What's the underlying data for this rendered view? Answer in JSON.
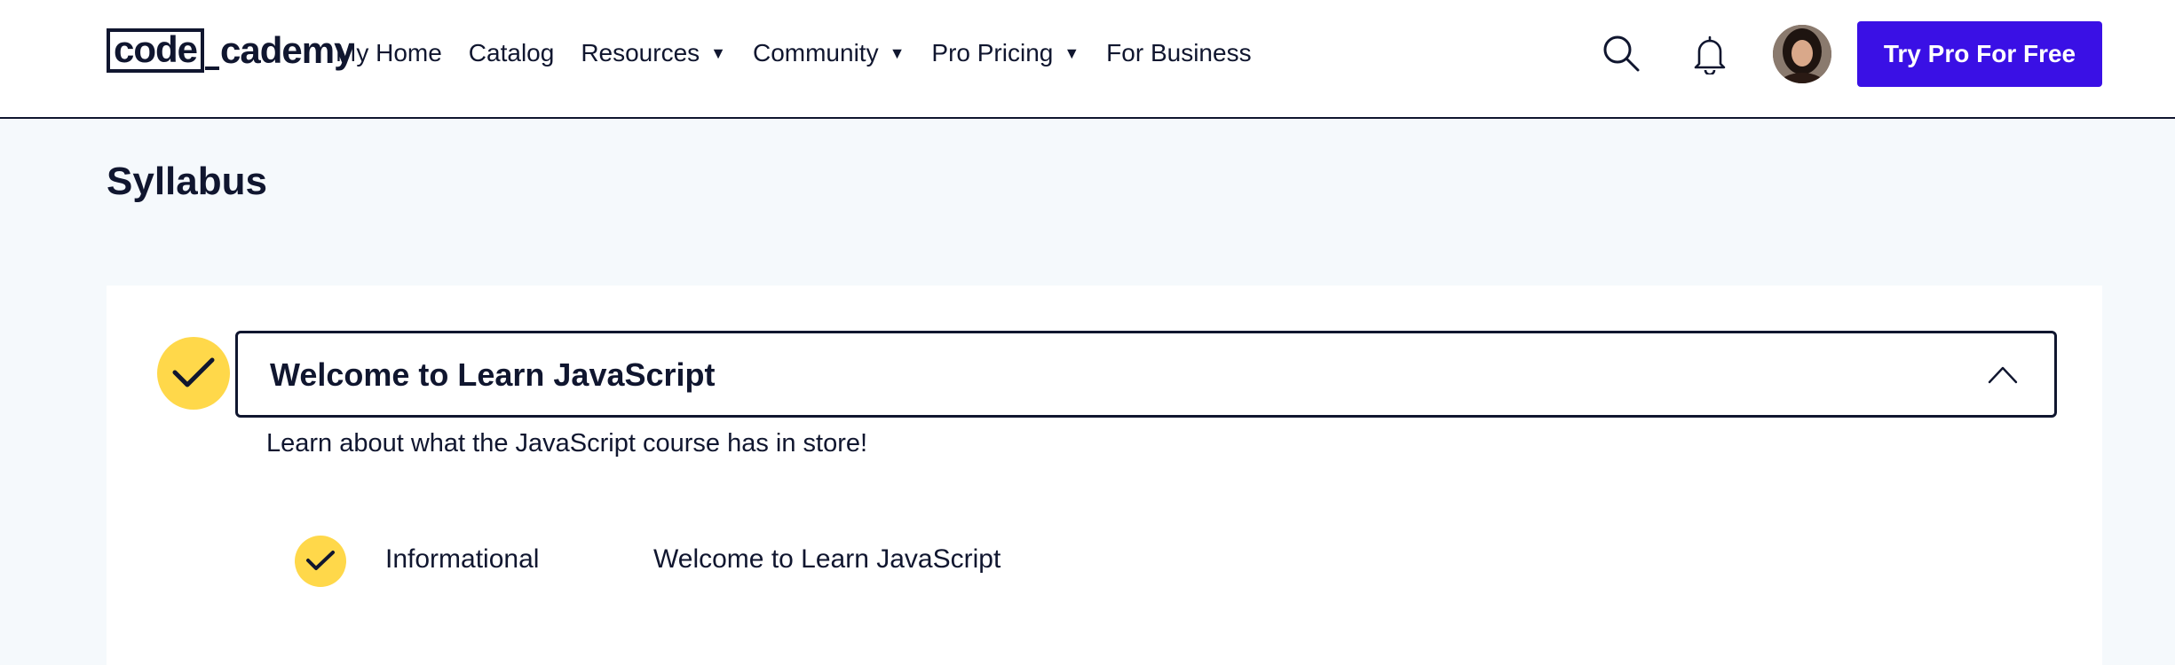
{
  "header": {
    "logo_box": "code",
    "logo_rest": "cademy",
    "nav": [
      {
        "label": "My Home",
        "has_caret": false
      },
      {
        "label": "Catalog",
        "has_caret": false
      },
      {
        "label": "Resources",
        "has_caret": true
      },
      {
        "label": "Community",
        "has_caret": true
      },
      {
        "label": "Pro Pricing",
        "has_caret": true
      },
      {
        "label": "For Business",
        "has_caret": false
      }
    ],
    "caret_glyph": "▼",
    "icons": [
      "search-icon",
      "bell-icon",
      "avatar"
    ],
    "cta_label": "Try Pro For Free"
  },
  "main": {
    "page_title": "Syllabus",
    "module": {
      "title": "Welcome to Learn JavaScript",
      "description": "Learn about what the JavaScript course has in store!",
      "completed": true,
      "expanded": true,
      "items": [
        {
          "type": "Informational",
          "title": "Welcome to Learn JavaScript",
          "completed": true
        }
      ]
    }
  },
  "colors": {
    "brand_blue": "#3a10e5",
    "navy": "#10162f",
    "check_yellow": "#ffd84a",
    "page_bg": "#f5f9fc"
  }
}
